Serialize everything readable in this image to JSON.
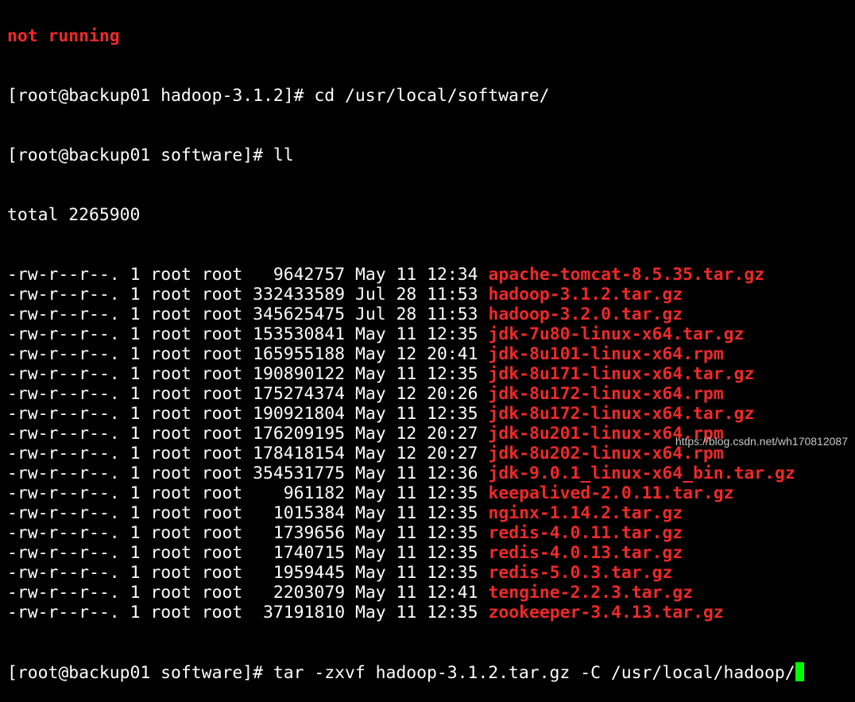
{
  "terminal": {
    "partial_top_line": "not running",
    "prompt_hadoop": "[root@backup01 hadoop-3.1.2]# ",
    "cmd_cd": "cd /usr/local/software/",
    "prompt_software": "[root@backup01 software]# ",
    "cmd_ll": "ll",
    "total_line": "total 2265900",
    "files": [
      {
        "perms": "-rw-r--r--.",
        "links": "1",
        "owner": "root",
        "group": "root",
        "size": "9642757",
        "month": "May",
        "day": "11",
        "time": "12:34",
        "name": "apache-tomcat-8.5.35.tar.gz"
      },
      {
        "perms": "-rw-r--r--.",
        "links": "1",
        "owner": "root",
        "group": "root",
        "size": "332433589",
        "month": "Jul",
        "day": "28",
        "time": "11:53",
        "name": "hadoop-3.1.2.tar.gz"
      },
      {
        "perms": "-rw-r--r--.",
        "links": "1",
        "owner": "root",
        "group": "root",
        "size": "345625475",
        "month": "Jul",
        "day": "28",
        "time": "11:53",
        "name": "hadoop-3.2.0.tar.gz"
      },
      {
        "perms": "-rw-r--r--.",
        "links": "1",
        "owner": "root",
        "group": "root",
        "size": "153530841",
        "month": "May",
        "day": "11",
        "time": "12:35",
        "name": "jdk-7u80-linux-x64.tar.gz"
      },
      {
        "perms": "-rw-r--r--.",
        "links": "1",
        "owner": "root",
        "group": "root",
        "size": "165955188",
        "month": "May",
        "day": "12",
        "time": "20:41",
        "name": "jdk-8u101-linux-x64.rpm"
      },
      {
        "perms": "-rw-r--r--.",
        "links": "1",
        "owner": "root",
        "group": "root",
        "size": "190890122",
        "month": "May",
        "day": "11",
        "time": "12:35",
        "name": "jdk-8u171-linux-x64.tar.gz"
      },
      {
        "perms": "-rw-r--r--.",
        "links": "1",
        "owner": "root",
        "group": "root",
        "size": "175274374",
        "month": "May",
        "day": "12",
        "time": "20:26",
        "name": "jdk-8u172-linux-x64.rpm"
      },
      {
        "perms": "-rw-r--r--.",
        "links": "1",
        "owner": "root",
        "group": "root",
        "size": "190921804",
        "month": "May",
        "day": "11",
        "time": "12:35",
        "name": "jdk-8u172-linux-x64.tar.gz"
      },
      {
        "perms": "-rw-r--r--.",
        "links": "1",
        "owner": "root",
        "group": "root",
        "size": "176209195",
        "month": "May",
        "day": "12",
        "time": "20:27",
        "name": "jdk-8u201-linux-x64.rpm"
      },
      {
        "perms": "-rw-r--r--.",
        "links": "1",
        "owner": "root",
        "group": "root",
        "size": "178418154",
        "month": "May",
        "day": "12",
        "time": "20:27",
        "name": "jdk-8u202-linux-x64.rpm"
      },
      {
        "perms": "-rw-r--r--.",
        "links": "1",
        "owner": "root",
        "group": "root",
        "size": "354531775",
        "month": "May",
        "day": "11",
        "time": "12:36",
        "name": "jdk-9.0.1_linux-x64_bin.tar.gz"
      },
      {
        "perms": "-rw-r--r--.",
        "links": "1",
        "owner": "root",
        "group": "root",
        "size": "961182",
        "month": "May",
        "day": "11",
        "time": "12:35",
        "name": "keepalived-2.0.11.tar.gz"
      },
      {
        "perms": "-rw-r--r--.",
        "links": "1",
        "owner": "root",
        "group": "root",
        "size": "1015384",
        "month": "May",
        "day": "11",
        "time": "12:35",
        "name": "nginx-1.14.2.tar.gz"
      },
      {
        "perms": "-rw-r--r--.",
        "links": "1",
        "owner": "root",
        "group": "root",
        "size": "1739656",
        "month": "May",
        "day": "11",
        "time": "12:35",
        "name": "redis-4.0.11.tar.gz"
      },
      {
        "perms": "-rw-r--r--.",
        "links": "1",
        "owner": "root",
        "group": "root",
        "size": "1740715",
        "month": "May",
        "day": "11",
        "time": "12:35",
        "name": "redis-4.0.13.tar.gz"
      },
      {
        "perms": "-rw-r--r--.",
        "links": "1",
        "owner": "root",
        "group": "root",
        "size": "1959445",
        "month": "May",
        "day": "11",
        "time": "12:35",
        "name": "redis-5.0.3.tar.gz"
      },
      {
        "perms": "-rw-r--r--.",
        "links": "1",
        "owner": "root",
        "group": "root",
        "size": "2203079",
        "month": "May",
        "day": "11",
        "time": "12:41",
        "name": "tengine-2.2.3.tar.gz"
      },
      {
        "perms": "-rw-r--r--.",
        "links": "1",
        "owner": "root",
        "group": "root",
        "size": "37191810",
        "month": "May",
        "day": "11",
        "time": "12:35",
        "name": "zookeeper-3.4.13.tar.gz"
      }
    ],
    "cmd_tar": "tar -zxvf hadoop-3.1.2.tar.gz -C /usr/local/hadoop/"
  },
  "watermark": "https://blog.csdn.net/wh170812087",
  "colors": {
    "background": "#000000",
    "foreground": "#ffffff",
    "archive_filename": "#ef2929",
    "cursor": "#00ff00"
  }
}
